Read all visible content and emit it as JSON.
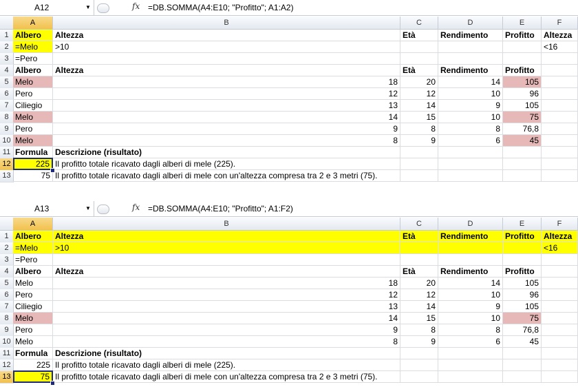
{
  "columns": [
    "A",
    "B",
    "C",
    "D",
    "E",
    "F"
  ],
  "panes": [
    {
      "name_box": "A12",
      "formula": "=DB.SOMMA(A4:E10; \"Profitto\"; A1:A2)",
      "selected_col": "A",
      "selected_row": 12,
      "rows": [
        {
          "n": "1",
          "A": "Albero",
          "B": "Altezza",
          "C": "Età",
          "D": "Rendimento",
          "E": "Profitto",
          "F": "Altezza"
        },
        {
          "n": "2",
          "A": "=Melo",
          "B": ">10",
          "C": "",
          "D": "",
          "E": "",
          "F": "<16"
        },
        {
          "n": "3",
          "A": "=Pero",
          "B": "",
          "C": "",
          "D": "",
          "E": "",
          "F": ""
        },
        {
          "n": "4",
          "A": "Albero",
          "B": "Altezza",
          "C": "Età",
          "D": "Rendimento",
          "E": "Profitto",
          "F": ""
        },
        {
          "n": "5",
          "A": "Melo",
          "B": "18",
          "C": "20",
          "D": "14",
          "E": "105",
          "F": ""
        },
        {
          "n": "6",
          "A": "Pero",
          "B": "12",
          "C": "12",
          "D": "10",
          "E": "96",
          "F": ""
        },
        {
          "n": "7",
          "A": "Ciliegio",
          "B": "13",
          "C": "14",
          "D": "9",
          "E": "105",
          "F": ""
        },
        {
          "n": "8",
          "A": "Melo",
          "B": "14",
          "C": "15",
          "D": "10",
          "E": "75",
          "F": ""
        },
        {
          "n": "9",
          "A": "Pero",
          "B": "9",
          "C": "8",
          "D": "8",
          "E": "76,8",
          "F": ""
        },
        {
          "n": "10",
          "A": "Melo",
          "B": "8",
          "C": "9",
          "D": "6",
          "E": "45",
          "F": ""
        },
        {
          "n": "11",
          "A": "Formula",
          "B": "Descrizione (risultato)",
          "C": "",
          "D": "",
          "E": "",
          "F": ""
        },
        {
          "n": "12",
          "A": "225",
          "B": "Il profitto totale ricavato dagli alberi di mele (225).",
          "C": "",
          "D": "",
          "E": "",
          "F": ""
        },
        {
          "n": "13",
          "A": "75",
          "B": "Il profitto totale ricavato dagli alberi di mele con un'altezza compresa tra 2 e 3 metri (75).",
          "C": "",
          "D": "",
          "E": "",
          "F": ""
        }
      ]
    },
    {
      "name_box": "A13",
      "formula": "=DB.SOMMA(A4:E10; \"Profitto\"; A1:F2)",
      "selected_col": "A",
      "selected_row": 13,
      "rows": [
        {
          "n": "1",
          "A": "Albero",
          "B": "Altezza",
          "C": "Età",
          "D": "Rendimento",
          "E": "Profitto",
          "F": "Altezza"
        },
        {
          "n": "2",
          "A": "=Melo",
          "B": ">10",
          "C": "",
          "D": "",
          "E": "",
          "F": "<16"
        },
        {
          "n": "3",
          "A": "=Pero",
          "B": "",
          "C": "",
          "D": "",
          "E": "",
          "F": ""
        },
        {
          "n": "4",
          "A": "Albero",
          "B": "Altezza",
          "C": "Età",
          "D": "Rendimento",
          "E": "Profitto",
          "F": ""
        },
        {
          "n": "5",
          "A": "Melo",
          "B": "18",
          "C": "20",
          "D": "14",
          "E": "105",
          "F": ""
        },
        {
          "n": "6",
          "A": "Pero",
          "B": "12",
          "C": "12",
          "D": "10",
          "E": "96",
          "F": ""
        },
        {
          "n": "7",
          "A": "Ciliegio",
          "B": "13",
          "C": "14",
          "D": "9",
          "E": "105",
          "F": ""
        },
        {
          "n": "8",
          "A": "Melo",
          "B": "14",
          "C": "15",
          "D": "10",
          "E": "75",
          "F": ""
        },
        {
          "n": "9",
          "A": "Pero",
          "B": "9",
          "C": "8",
          "D": "8",
          "E": "76,8",
          "F": ""
        },
        {
          "n": "10",
          "A": "Melo",
          "B": "8",
          "C": "9",
          "D": "6",
          "E": "45",
          "F": ""
        },
        {
          "n": "11",
          "A": "Formula",
          "B": "Descrizione (risultato)",
          "C": "",
          "D": "",
          "E": "",
          "F": ""
        },
        {
          "n": "12",
          "A": "225",
          "B": "Il profitto totale ricavato dagli alberi di mele (225).",
          "C": "",
          "D": "",
          "E": "",
          "F": ""
        },
        {
          "n": "13",
          "A": "75",
          "B": "Il profitto totale ricavato dagli alberi di mele con un'altezza compresa tra 2 e 3 metri (75).",
          "C": "",
          "D": "",
          "E": "",
          "F": ""
        }
      ]
    }
  ],
  "colors": {
    "highlight_yellow": "#ffff00",
    "highlight_pink": "#e6b8b7",
    "selection_border": "#1e2a7a"
  }
}
